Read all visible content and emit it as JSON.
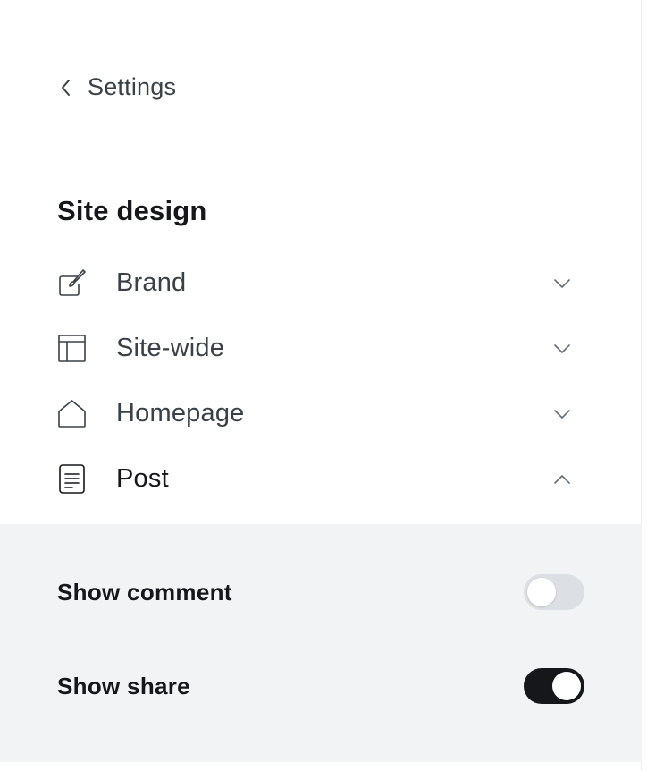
{
  "header": {
    "back_label": "Settings",
    "back_icon": "chevron-left-icon"
  },
  "section": {
    "title": "Site design"
  },
  "nav": {
    "items": [
      {
        "label": "Brand",
        "icon": "brush-icon",
        "expanded": false
      },
      {
        "label": "Site-wide",
        "icon": "layout-icon",
        "expanded": false
      },
      {
        "label": "Homepage",
        "icon": "home-icon",
        "expanded": false
      },
      {
        "label": "Post",
        "icon": "document-icon",
        "expanded": true
      }
    ]
  },
  "post_settings": {
    "toggles": [
      {
        "label": "Show comment",
        "enabled": false
      },
      {
        "label": "Show share",
        "enabled": true
      }
    ]
  },
  "colors": {
    "panel_bg": "#ffffff",
    "sub_panel_bg": "#f1f3f4",
    "toggle_on": "#15171a",
    "toggle_off": "#dcdfe3",
    "text_primary": "#15171a",
    "text_secondary": "#394047"
  }
}
